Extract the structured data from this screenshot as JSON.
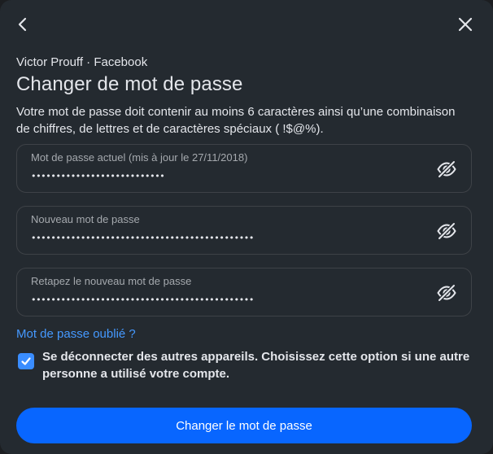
{
  "header": {
    "back_icon": "chevron-left-icon",
    "close_icon": "close-icon"
  },
  "account_line": "Victor Prouff · Facebook",
  "title": "Changer de mot de passe",
  "description": "Votre mot de passe doit contenir au moins 6 caractères ainsi qu’une combinaison de chiffres, de lettres et de caractères spéciaux ( !$@%).",
  "fields": [
    {
      "label": "Mot de passe actuel (mis à jour le 27/11/2018)",
      "value": "•••••••••••••••••••••••••••",
      "toggle_icon": "eye-slash-icon"
    },
    {
      "label": "Nouveau mot de passe",
      "value": "•••••••••••••••••••••••••••••••••••••••••••••",
      "toggle_icon": "eye-slash-icon"
    },
    {
      "label": "Retapez le nouveau mot de passe",
      "value": "•••••••••••••••••••••••••••••••••••••••••••••",
      "toggle_icon": "eye-slash-icon"
    }
  ],
  "forgot_link": "Mot de passe oublié ?",
  "logout_option": {
    "checked": true,
    "label": "Se déconnecter des autres appareils. Choisissez cette option si une autre personne a utilisé votre compte."
  },
  "submit_label": "Changer le mot de passe",
  "colors": {
    "background": "#242a30",
    "accent": "#0866ff",
    "link": "#4599ff",
    "checkbox": "#3a8dff",
    "field_border": "#3e4247"
  }
}
